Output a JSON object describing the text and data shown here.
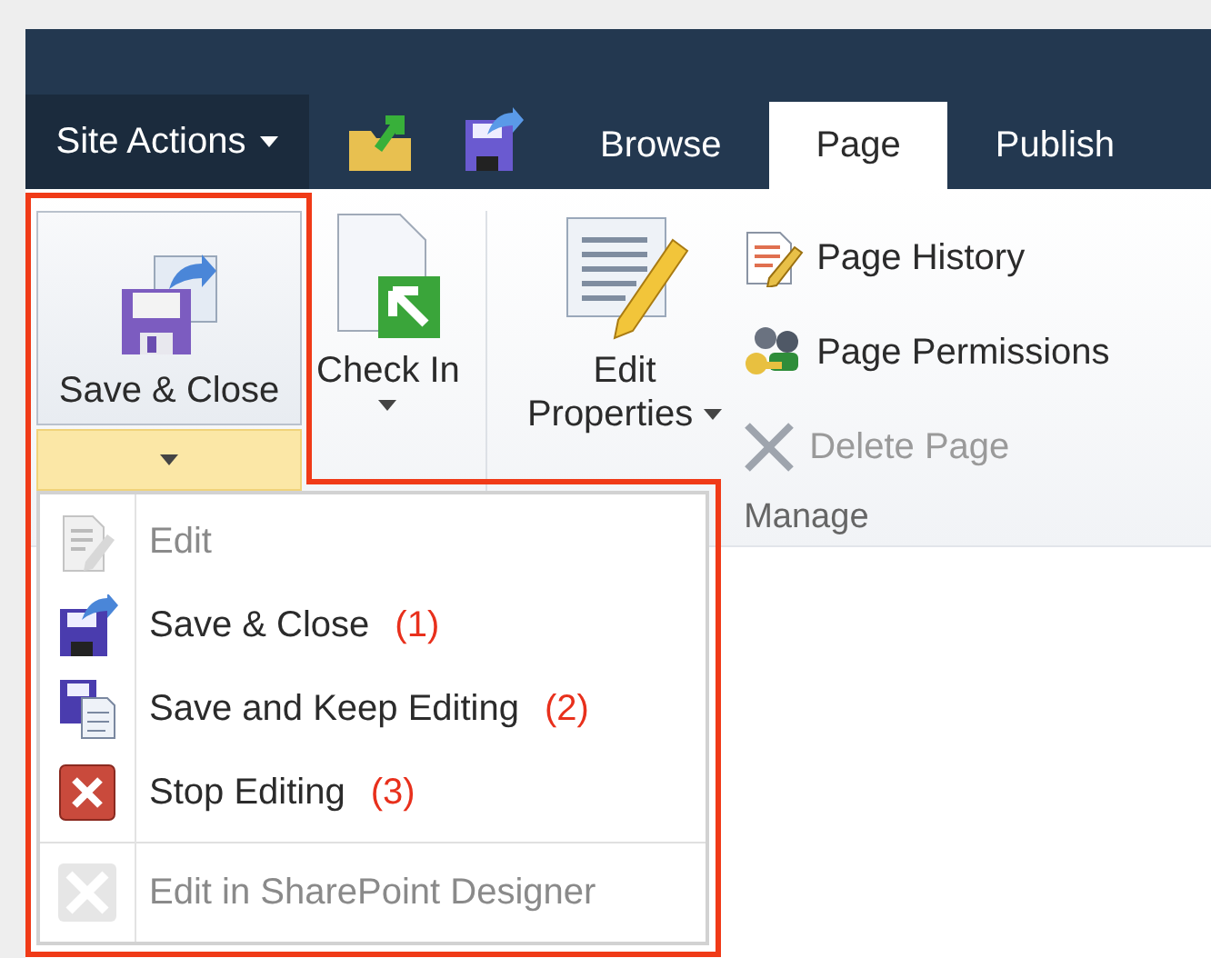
{
  "header": {
    "site_actions": "Site Actions",
    "tabs": [
      {
        "label": "Browse",
        "selected": false
      },
      {
        "label": "Page",
        "selected": true
      },
      {
        "label": "Publish",
        "selected": false
      }
    ]
  },
  "ribbon": {
    "large_buttons": [
      {
        "kind": "split",
        "lines": [
          "Save & Close"
        ],
        "open": true
      },
      {
        "kind": "arrow-below",
        "lines": [
          "Check In"
        ],
        "open": false
      },
      {
        "kind": "arrow-inline",
        "lines": [
          "Edit",
          "Properties"
        ],
        "open": false
      }
    ],
    "small_buttons": [
      {
        "label": "Page History",
        "disabled": false
      },
      {
        "label": "Page Permissions",
        "disabled": false
      },
      {
        "label": "Delete Page",
        "disabled": true
      }
    ],
    "group_label": "Manage"
  },
  "menu": {
    "items": [
      {
        "kind": "item",
        "label": "Edit",
        "disabled": true
      },
      {
        "kind": "item",
        "label": "Save & Close",
        "note": "(1)",
        "disabled": false
      },
      {
        "kind": "item",
        "label": "Save and Keep Editing",
        "note": "(2)",
        "disabled": false
      },
      {
        "kind": "item",
        "label": "Stop Editing",
        "note": "(3)",
        "disabled": false
      },
      {
        "kind": "separator"
      },
      {
        "kind": "item",
        "label": "Edit in SharePoint Designer",
        "disabled": true
      }
    ]
  }
}
